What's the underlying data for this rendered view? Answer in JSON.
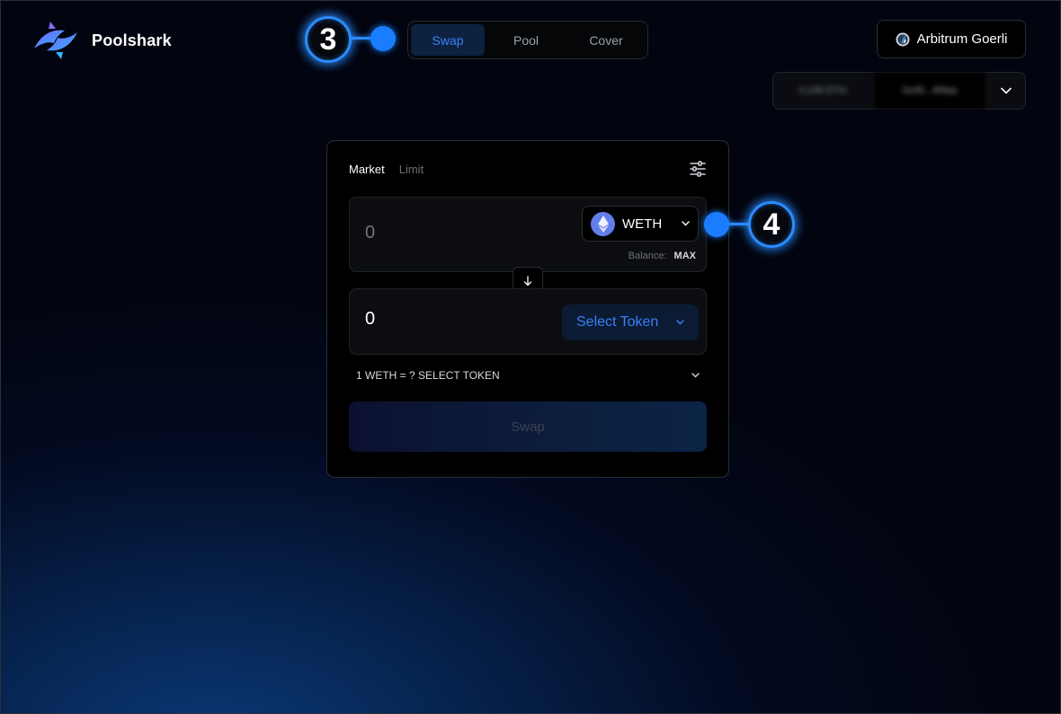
{
  "app": {
    "name": "Poolshark"
  },
  "nav": {
    "tabs": [
      "Swap",
      "Pool",
      "Cover"
    ],
    "active": "Swap"
  },
  "network": {
    "label": "Arbitrum Goerli"
  },
  "wallet": {
    "balance": "0.249 ETH",
    "address": "0x45...4f4aa"
  },
  "annotations": {
    "marker_nav": "3",
    "marker_token": "4"
  },
  "swap_card": {
    "tabs": {
      "market": "Market",
      "limit": "Limit"
    },
    "input": {
      "placeholder": "0",
      "token": "WETH",
      "balance_label": "Balance:",
      "max_label": "MAX"
    },
    "output": {
      "value": "0",
      "select_label": "Select Token"
    },
    "rate": "1 WETH = ? SELECT TOKEN",
    "action_label": "Swap"
  },
  "colors": {
    "accent": "#3b82f6",
    "marker": "#2b8cff",
    "eth": "#627eea"
  }
}
